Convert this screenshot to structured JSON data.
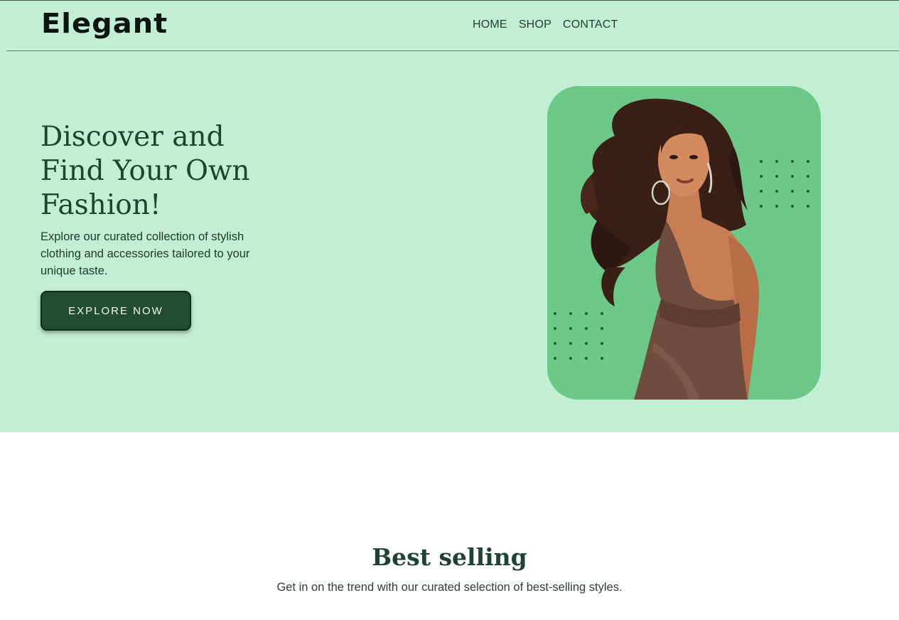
{
  "brand": {
    "logo_text": "Elegant"
  },
  "nav": {
    "items": [
      {
        "label": "HOME"
      },
      {
        "label": "SHOP"
      },
      {
        "label": "CONTACT"
      }
    ]
  },
  "hero": {
    "title_lines": [
      "Discover and",
      "Find Your Own",
      "Fashion!"
    ],
    "description": "Explore our curated collection of stylish clothing and accessories tailored to your unique taste.",
    "cta_label": "EXPLORE NOW"
  },
  "best_selling": {
    "title": "Best selling",
    "subtitle": "Get in on the trend with our curated selection of best-selling styles."
  },
  "colors": {
    "hero_background": "#c2eed4",
    "card_background": "#6cc886",
    "accent_dark": "#224c32",
    "heading": "#1e4330"
  }
}
